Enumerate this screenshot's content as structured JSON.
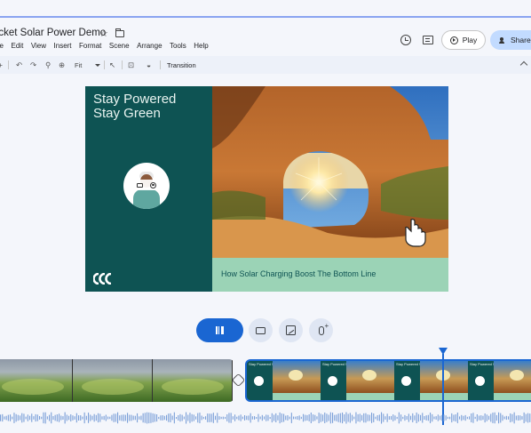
{
  "app": {
    "title": "ocket Solar Power Demo",
    "star_icon": "star-icon",
    "folder_icon": "folder-icon"
  },
  "menu": [
    "ile",
    "Edit",
    "View",
    "Insert",
    "Format",
    "Scene",
    "Arrange",
    "Tools",
    "Help"
  ],
  "header": {
    "history_icon": "history-icon",
    "comment_icon": "comment-icon",
    "play_label": "Play",
    "share_label": "Share"
  },
  "toolbar": {
    "zoom_label": "Fit",
    "transition_label": "Transition"
  },
  "slide": {
    "headline_line1": "Stay Powered",
    "headline_line2": "Stay Green",
    "caption": "How Solar Charging Boost The Bottom Line",
    "logo_text": "CC"
  },
  "thumbnails": {
    "headline": "Stay Powered Stay Green",
    "count": 4
  },
  "controls": {
    "pause_icon": "pause-icon",
    "captions_icon": "captions-icon",
    "image_icon": "image-icon",
    "mic_icon": "mic-add-icon"
  },
  "colors": {
    "accent": "#1a66d2",
    "slide_dark": "#0e5353",
    "slide_caption": "#9bd3b6",
    "share_bg": "#c2dbff"
  }
}
